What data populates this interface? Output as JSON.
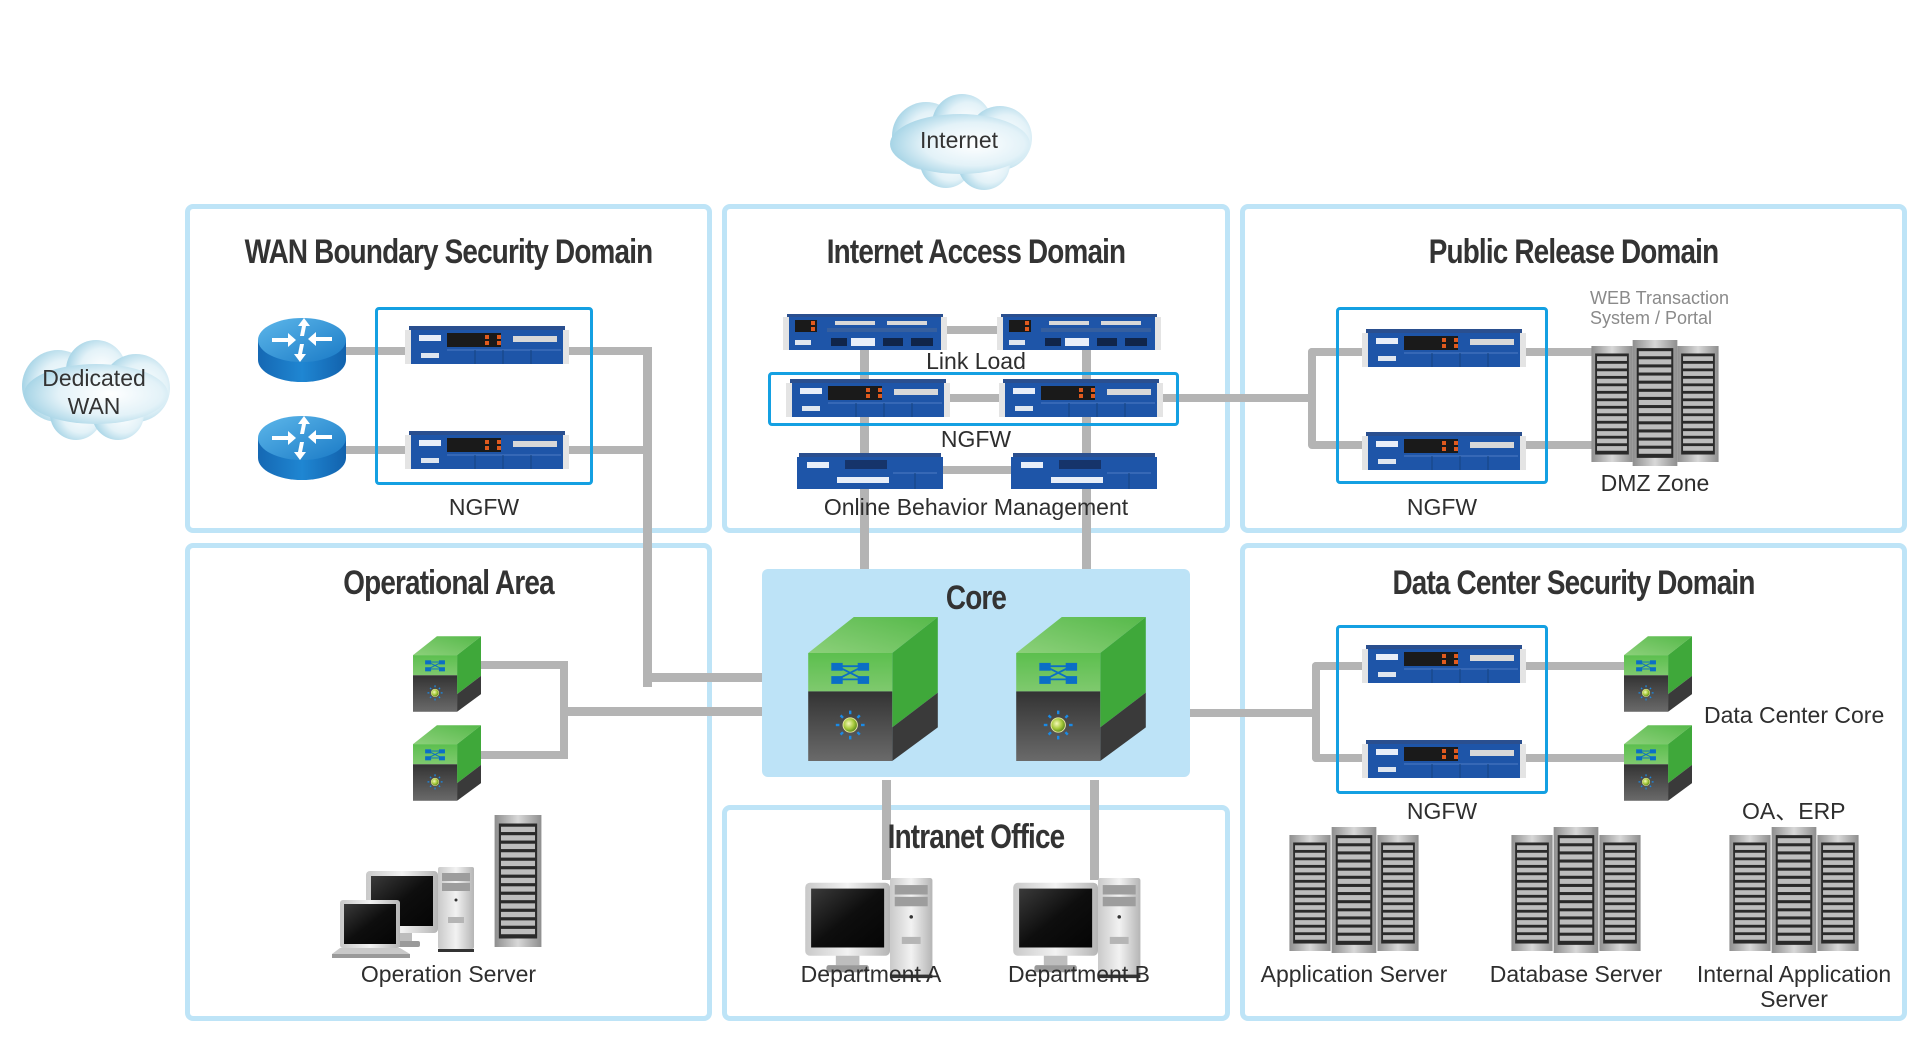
{
  "clouds": {
    "internet": "Internet",
    "dedicated_wan_line1": "Dedicated",
    "dedicated_wan_line2": "WAN"
  },
  "zones": {
    "wan": {
      "title": "WAN Boundary Security Domain",
      "ngfw_label": "NGFW",
      "devices": [
        "router-icon",
        "router-icon",
        "firewall-icon",
        "firewall-icon"
      ]
    },
    "internet_access": {
      "title": "Internet Access Domain",
      "link_load_label": "Link Load",
      "ngfw_label": "NGFW",
      "obm_label": "Online Behavior Management"
    },
    "public_release": {
      "title": "Public Release Domain",
      "web_label_line1": "WEB Transaction",
      "web_label_line2": "System / Portal",
      "ngfw_label": "NGFW",
      "dmz_label": "DMZ Zone"
    },
    "operational": {
      "title": "Operational Area",
      "server_label": "Operation Server"
    },
    "core": {
      "title": "Core"
    },
    "intranet": {
      "title": "Intranet Office",
      "dept_a": "Department A",
      "dept_b": "Department B"
    },
    "data_center": {
      "title": "Data Center Security Domain",
      "ngfw_label": "NGFW",
      "dc_core_label": "Data Center Core",
      "oa_erp_label": "OA、ERP",
      "app_server_label": "Application Server",
      "db_server_label": "Database Server",
      "internal_app_line1": "Internal Application",
      "internal_app_line2": "Server"
    }
  },
  "colors": {
    "zone_border": "#bee4f7",
    "core_fill": "#bde3f7",
    "ngfw_group_border": "#14a0e2",
    "wire": "#b4b4b4",
    "device_blue": "#1d4f9c",
    "switch_green": "#5cbf4e",
    "switch_dark": "#3f3f3f"
  }
}
